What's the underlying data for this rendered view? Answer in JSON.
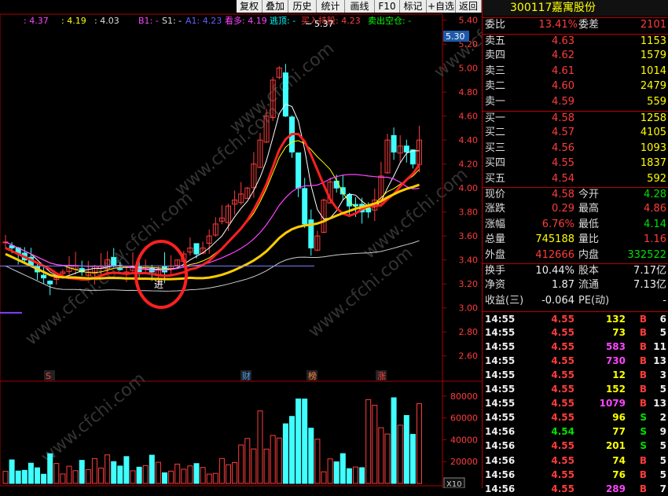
{
  "toolbar": [
    "复权",
    "叠加",
    "历史",
    "统计",
    "画线",
    "F10",
    "标记",
    "+自选",
    "返回"
  ],
  "indicator_bar": {
    "v1": ": 4.37",
    "v2": ": 4.19",
    "v3": ": 4.03",
    "b1": "B1: -",
    "s1": "S1: -",
    "a1": "A1: 4.23",
    "kanduo": "看多: 4.19",
    "taoding": "逃顶: -",
    "mairu": "买入持股: 4.23",
    "maichu": "卖出空仓: -"
  },
  "price_axis": [
    "5.40",
    "5.20",
    "5.00",
    "4.80",
    "4.60",
    "4.40",
    "4.20",
    "4.00",
    "3.80",
    "3.60",
    "3.40",
    "3.20",
    "3.00",
    "2.80",
    "2.60"
  ],
  "price_badge": "5.30",
  "high_label": "5.37",
  "jin_label": "进",
  "markers": {
    "s": "S",
    "cai": "财",
    "bang": "榜",
    "zhang": "涨"
  },
  "volume_axis": [
    "80000",
    "60000",
    "40000",
    "20000"
  ],
  "vol_unit": "X10",
  "watermark": "www.cfchi.com",
  "stock": {
    "code": "300117",
    "name": "嘉寓股份"
  },
  "weibi": {
    "label": "委比",
    "value": "13.41%",
    "label2": "委差",
    "value2": "2101"
  },
  "asks": [
    {
      "label": "卖五",
      "price": "4.63",
      "vol": "1153"
    },
    {
      "label": "卖四",
      "price": "4.62",
      "vol": "1579"
    },
    {
      "label": "卖三",
      "price": "4.61",
      "vol": "1014"
    },
    {
      "label": "卖二",
      "price": "4.60",
      "vol": "2479"
    },
    {
      "label": "卖一",
      "price": "4.59",
      "vol": "559"
    }
  ],
  "bids": [
    {
      "label": "买一",
      "price": "4.58",
      "vol": "1258"
    },
    {
      "label": "买二",
      "price": "4.57",
      "vol": "4105"
    },
    {
      "label": "买三",
      "price": "4.56",
      "vol": "1093"
    },
    {
      "label": "买四",
      "price": "4.55",
      "vol": "1837"
    },
    {
      "label": "买五",
      "price": "4.54",
      "vol": "592"
    }
  ],
  "quote": [
    {
      "l1": "现价",
      "v1": "4.58",
      "c1": "red",
      "l2": "今开",
      "v2": "4.28",
      "c2": "grn"
    },
    {
      "l1": "涨跌",
      "v1": "0.29",
      "c1": "red",
      "l2": "最高",
      "v2": "4.86",
      "c2": "red"
    },
    {
      "l1": "涨幅",
      "v1": "6.76%",
      "c1": "red",
      "l2": "最低",
      "v2": "4.14",
      "c2": "grn"
    },
    {
      "l1": "总量",
      "v1": "745188",
      "c1": "yel",
      "l2": "量比",
      "v2": "1.16",
      "c2": "red"
    },
    {
      "l1": "外盘",
      "v1": "412666",
      "c1": "red",
      "l2": "内盘",
      "v2": "332522",
      "c2": "grn"
    }
  ],
  "quote2": [
    {
      "l1": "换手",
      "v1": "10.44%",
      "l2": "股本",
      "v2": "7.17亿"
    },
    {
      "l1": "净资",
      "v1": "1.87",
      "l2": "流通",
      "v2": "7.13亿"
    },
    {
      "l1": "收益(三)",
      "v1": "-0.064",
      "l2": "PE(动)",
      "v2": "-"
    }
  ],
  "trades": [
    {
      "t": "14:55",
      "p": "4.55",
      "v": "132",
      "vc": "yel",
      "d": "B",
      "n": "6"
    },
    {
      "t": "14:55",
      "p": "4.55",
      "v": "73",
      "vc": "yel",
      "d": "B",
      "n": "5"
    },
    {
      "t": "14:55",
      "p": "4.55",
      "v": "583",
      "vc": "mag",
      "d": "B",
      "n": "11"
    },
    {
      "t": "14:55",
      "p": "4.55",
      "v": "730",
      "vc": "mag",
      "d": "B",
      "n": "13"
    },
    {
      "t": "14:55",
      "p": "4.55",
      "v": "12",
      "vc": "yel",
      "d": "B",
      "n": "3"
    },
    {
      "t": "14:55",
      "p": "4.55",
      "v": "152",
      "vc": "yel",
      "d": "B",
      "n": "5"
    },
    {
      "t": "14:55",
      "p": "4.55",
      "v": "1079",
      "vc": "mag",
      "d": "B",
      "n": "13"
    },
    {
      "t": "14:55",
      "p": "4.55",
      "v": "96",
      "vc": "yel",
      "d": "S",
      "n": "2"
    },
    {
      "t": "14:56",
      "p": "4.54",
      "v": "77",
      "vc": "yel",
      "d": "S",
      "n": "9"
    },
    {
      "t": "14:56",
      "p": "4.55",
      "v": "201",
      "vc": "yel",
      "d": "S",
      "n": "5"
    },
    {
      "t": "14:56",
      "p": "4.55",
      "v": "74",
      "vc": "yel",
      "d": "B",
      "n": "5"
    },
    {
      "t": "14:56",
      "p": "4.55",
      "v": "76",
      "vc": "yel",
      "d": "B",
      "n": "5"
    },
    {
      "t": "14:56",
      "p": "4.55",
      "v": "289",
      "vc": "mag",
      "d": "B",
      "n": "7"
    }
  ],
  "chart_data": {
    "type": "candlestick",
    "price_range": [
      2.5,
      5.45
    ],
    "volume_range": [
      0,
      90000
    ],
    "high": 5.37
  }
}
